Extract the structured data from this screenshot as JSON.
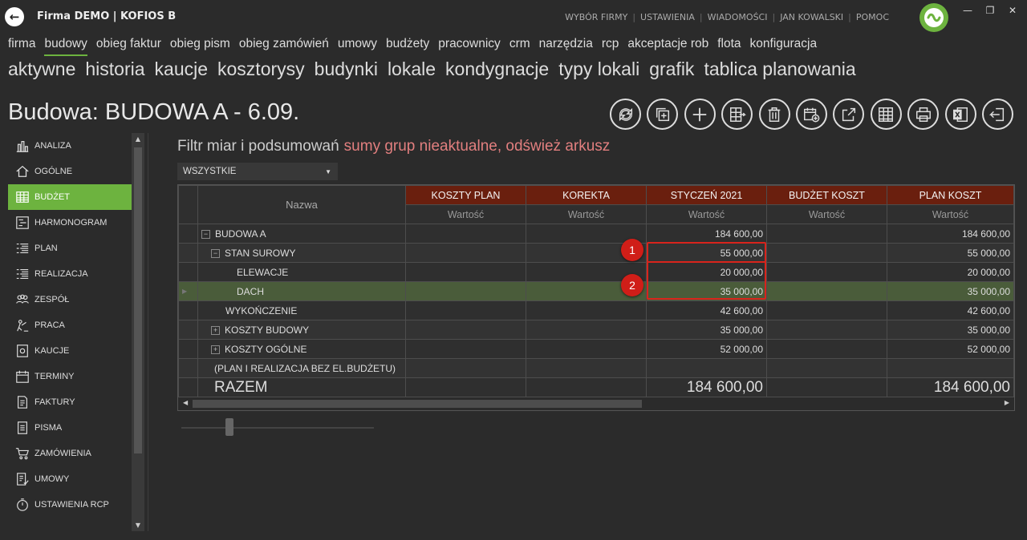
{
  "app": {
    "title": "Firma DEMO | KOFIOS B",
    "top_links": [
      "WYBÓR FIRMY",
      "USTAWIENIA",
      "WIADOMOŚCI",
      "JAN KOWALSKI",
      "POMOC"
    ],
    "window_buttons": [
      "minimize-icon",
      "restore-icon",
      "close-icon"
    ],
    "accent_color": "#6db33f",
    "header_color": "#6a1f0e",
    "marker_color": "#d01e18"
  },
  "nav_main": [
    "firma",
    "budowy",
    "obieg faktur",
    "obieg pism",
    "obieg zamówień",
    "umowy",
    "budżety",
    "pracownicy",
    "crm",
    "narzędzia",
    "rcp",
    "akceptacje rob",
    "flota",
    "konfiguracja"
  ],
  "nav_main_active": "budowy",
  "nav_sub": [
    "aktywne",
    "historia",
    "kaucje",
    "kosztorysy",
    "budynki",
    "lokale",
    "kondygnacje",
    "typy lokali",
    "grafik",
    "tablica planowania"
  ],
  "page_title": "Budowa: BUDOWA A - 6.09.",
  "toolbar": [
    "refresh-icon",
    "copy-add-icon",
    "add-icon",
    "grid-export-icon",
    "delete-icon",
    "calendar-add-icon",
    "external-link-icon",
    "table-icon",
    "print-icon",
    "excel-icon",
    "exit-icon"
  ],
  "sidebar": {
    "active": "BUDŻET",
    "items": [
      {
        "label": "ANALIZA",
        "icon": "bar-chart-icon"
      },
      {
        "label": "OGÓLNE",
        "icon": "home-icon"
      },
      {
        "label": "BUDŻET",
        "icon": "spreadsheet-icon"
      },
      {
        "label": "HARMONOGRAM",
        "icon": "schedule-icon"
      },
      {
        "label": "PLAN",
        "icon": "plan-list-icon"
      },
      {
        "label": "REALIZACJA",
        "icon": "realization-list-icon"
      },
      {
        "label": "ZESPÓŁ",
        "icon": "team-icon"
      },
      {
        "label": "PRACA",
        "icon": "work-icon"
      },
      {
        "label": "KAUCJE",
        "icon": "deposit-icon"
      },
      {
        "label": "TERMINY",
        "icon": "calendar-icon"
      },
      {
        "label": "FAKTURY",
        "icon": "invoice-icon"
      },
      {
        "label": "PISMA",
        "icon": "letter-icon"
      },
      {
        "label": "ZAMÓWIENIA",
        "icon": "cart-icon"
      },
      {
        "label": "UMOWY",
        "icon": "contract-icon"
      },
      {
        "label": "USTAWIENIA RCP",
        "icon": "stopwatch-icon"
      }
    ]
  },
  "filter": {
    "title": "Filtr miar i podsumowań",
    "warning": "sumy grup nieaktualne, odśwież arkusz",
    "dropdown_value": "WSZYSTKIE"
  },
  "grid": {
    "name_header": "Nazwa",
    "columns": [
      "KOSZTY PLAN",
      "KOREKTA",
      "STYCZEŃ 2021",
      "BUDŻET KOSZT",
      "PLAN KOSZT"
    ],
    "subheader": "Wartość",
    "rows": [
      {
        "name": "BUDOWA A",
        "level": 0,
        "expander": "−",
        "values": [
          "",
          "",
          "184 600,00",
          "",
          "184 600,00"
        ]
      },
      {
        "name": "STAN SUROWY",
        "level": 1,
        "expander": "−",
        "values": [
          "",
          "",
          "55 000,00",
          "",
          "55 000,00"
        ]
      },
      {
        "name": "ELEWACJE",
        "level": 2,
        "expander": "",
        "values": [
          "",
          "",
          "20 000,00",
          "",
          "20 000,00"
        ]
      },
      {
        "name": "DACH",
        "level": 2,
        "expander": "",
        "values": [
          "",
          "",
          "35 000,00",
          "",
          "35 000,00"
        ],
        "selected": true
      },
      {
        "name": "WYKOŃCZENIE",
        "level": 1,
        "expander": "",
        "values": [
          "",
          "",
          "42 600,00",
          "",
          "42 600,00"
        ]
      },
      {
        "name": "KOSZTY BUDOWY",
        "level": 1,
        "expander": "+",
        "values": [
          "",
          "",
          "35 000,00",
          "",
          "35 000,00"
        ]
      },
      {
        "name": "KOSZTY OGÓLNE",
        "level": 1,
        "expander": "+",
        "values": [
          "",
          "",
          "52 000,00",
          "",
          "52 000,00"
        ]
      },
      {
        "name": "(PLAN I REALIZACJA BEZ EL.BUDŻETU)",
        "level": 0,
        "expander": "",
        "values": [
          "",
          "",
          "",
          "",
          ""
        ]
      }
    ],
    "total": {
      "name": "RAZEM",
      "values": [
        "",
        "",
        "184 600,00",
        "",
        "184 600,00"
      ]
    }
  },
  "markers": [
    "1",
    "2"
  ]
}
